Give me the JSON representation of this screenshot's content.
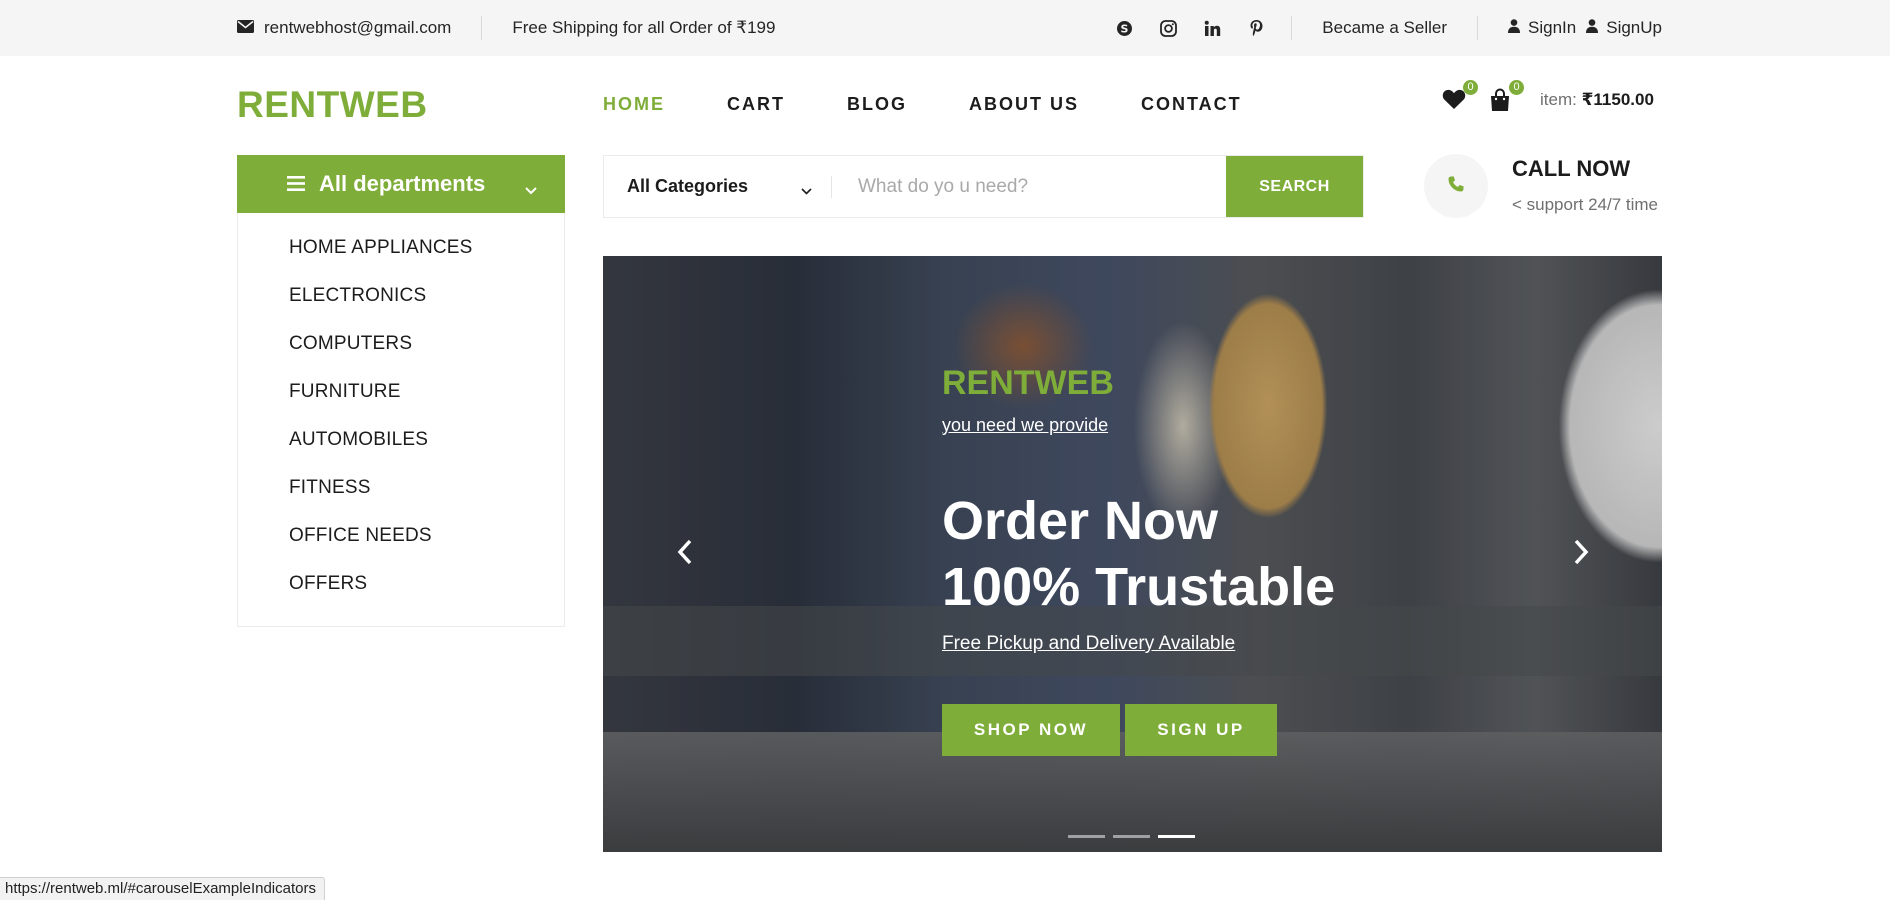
{
  "topbar": {
    "email": "rentwebhost@gmail.com",
    "shipping": "Free Shipping for all Order of ₹199",
    "social_icons": [
      "skype-icon",
      "instagram-icon",
      "linkedin-icon",
      "pinterest-icon"
    ],
    "seller": "Became a Seller",
    "signin": "SignIn",
    "signup": "SignUp"
  },
  "header": {
    "logo": "RENTWEB",
    "nav": [
      "HOME",
      "CART",
      "BLOG",
      "ABOUT US",
      "CONTACT"
    ],
    "active_nav": "HOME",
    "wishlist_count": "0",
    "cart_count": "0",
    "item_label": "item:",
    "item_total": "₹1150.00"
  },
  "departments": {
    "title": "All departments",
    "items": [
      "HOME APPLIANCES",
      "ELECTRONICS",
      "COMPUTERS",
      "FURNITURE",
      "AUTOMOBILES",
      "FITNESS",
      "OFFICE NEEDS",
      "OFFERS"
    ]
  },
  "search": {
    "category": "All Categories",
    "placeholder": "What do yo u need?",
    "button": "SEARCH"
  },
  "call": {
    "title": "CALL NOW",
    "subtitle": "< support 24/7 time"
  },
  "hero": {
    "brand": "RENTWEB",
    "tagline": "you need we provide",
    "title_line1": "Order Now",
    "title_line2": "100% Trustable",
    "note": "Free Pickup and Delivery Available",
    "shop_button": "SHOP NOW",
    "signup_button": "SIGN UP",
    "active_slide": 3,
    "slide_count": 3
  },
  "status_bar": "https://rentweb.ml/#carouselExampleIndicators",
  "colors": {
    "accent": "#7fad39",
    "topbar_bg": "#f5f5f5"
  }
}
